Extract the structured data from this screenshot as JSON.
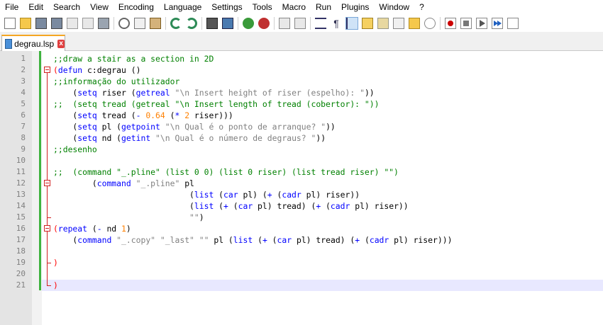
{
  "menu": [
    "File",
    "Edit",
    "Search",
    "View",
    "Encoding",
    "Language",
    "Settings",
    "Tools",
    "Macro",
    "Run",
    "Plugins",
    "Window",
    "?"
  ],
  "toolbar": {
    "icons": [
      "new-file-icon",
      "open-file-icon",
      "save-icon",
      "save-all-icon",
      "close-icon",
      "close-all-icon",
      "print-icon",
      "cut-icon",
      "copy-icon",
      "paste-icon",
      "undo-icon",
      "redo-icon",
      "find-icon",
      "replace-icon",
      "zoom-in-icon",
      "zoom-out-icon",
      "sync-vertical-icon",
      "sync-horizontal-icon",
      "word-wrap-icon",
      "show-all-chars-icon",
      "indent-guide-icon",
      "udl-icon",
      "doc-map-icon",
      "function-list-icon",
      "folder-as-workspace-icon",
      "monitoring-icon",
      "record-macro-icon",
      "stop-record-icon",
      "play-macro-icon",
      "run-macro-multiple-icon",
      "save-macro-icon"
    ]
  },
  "tab": {
    "label": "degrau.lsp",
    "close": "x"
  },
  "editor": {
    "current_line": 21,
    "lines": [
      {
        "n": "1",
        "text": ";;draw a stair as a section in 2D"
      },
      {
        "n": "2",
        "text": "(defun c:degrau ()"
      },
      {
        "n": "3",
        "text": ";;informação do utilizador"
      },
      {
        "n": "4",
        "text": "    (setq riser (getreal \"\\n Insert height of riser (espelho): \"))"
      },
      {
        "n": "5",
        "text": ";;  (setq tread (getreal \"\\n Insert length of tread (cobertor): \"))"
      },
      {
        "n": "6",
        "text": "    (setq tread (- 0.64 (* 2 riser)))"
      },
      {
        "n": "7",
        "text": "    (setq pl (getpoint \"\\n Qual é o ponto de arranque? \"))"
      },
      {
        "n": "8",
        "text": "    (setq nd (getint \"\\n Qual é o número de degraus? \"))"
      },
      {
        "n": "9",
        "text": ";;desenho"
      },
      {
        "n": "10",
        "text": ""
      },
      {
        "n": "11",
        "text": ";;  (command \"_.pline\" (list 0 0) (list 0 riser) (list tread riser) \"\")"
      },
      {
        "n": "12",
        "text": "        (command \"_.pline\" pl"
      },
      {
        "n": "13",
        "text": "                            (list (car pl) (+ (cadr pl) riser))"
      },
      {
        "n": "14",
        "text": "                            (list (+ (car pl) tread) (+ (cadr pl) riser))"
      },
      {
        "n": "15",
        "text": "                            \"\")"
      },
      {
        "n": "16",
        "text": "(repeat (- nd 1)"
      },
      {
        "n": "17",
        "text": "    (command \"_.copy\" \"_last\" \"\" pl (list (+ (car pl) tread) (+ (cadr pl) riser)))"
      },
      {
        "n": "18",
        "text": ""
      },
      {
        "n": "19",
        "text": ")"
      },
      {
        "n": "20",
        "text": ""
      },
      {
        "n": "21",
        "text": ")"
      }
    ]
  },
  "colors": {
    "comment": "#008000",
    "keyword": "#0000ff",
    "string": "#808080",
    "number": "#ff8000",
    "bracket": "#ff0000",
    "change_history": "#3fb33f",
    "current_line_bg": "#e8e8ff"
  }
}
